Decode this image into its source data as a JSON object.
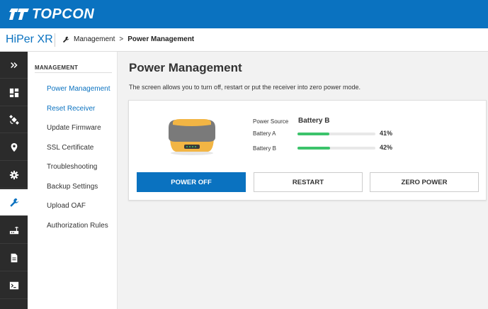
{
  "brand": {
    "logo_text": "TOPCON",
    "product": "HiPer XR"
  },
  "breadcrumb": {
    "parent": "Management",
    "separator": ">",
    "current": "Power Management"
  },
  "rail": {
    "items": [
      {
        "icon": "expand-icon"
      },
      {
        "icon": "dashboard-icon"
      },
      {
        "icon": "satellite-icon"
      },
      {
        "icon": "location-pin-icon"
      },
      {
        "icon": "gear-icon"
      },
      {
        "icon": "wrench-icon",
        "active": true
      },
      {
        "icon": "router-icon"
      },
      {
        "icon": "document-icon"
      },
      {
        "icon": "terminal-icon"
      }
    ]
  },
  "menu": {
    "title": "MANAGEMENT",
    "items": [
      {
        "label": "Power Management"
      },
      {
        "label": "Reset Receiver"
      },
      {
        "label": "Update Firmware"
      },
      {
        "label": "SSL Certificate"
      },
      {
        "label": "Troubleshooting"
      },
      {
        "label": "Backup Settings"
      },
      {
        "label": "Upload OAF"
      },
      {
        "label": "Authorization Rules"
      }
    ]
  },
  "main": {
    "title": "Power Management",
    "description": "The screen allows you to turn off, restart or put the receiver into zero power mode.",
    "power_source_label": "Power Source",
    "power_source_value": "Battery B",
    "batteries": [
      {
        "label": "Battery A",
        "percent_text": "41%",
        "level": 0.41
      },
      {
        "label": "Battery B",
        "percent_text": "42%",
        "level": 0.42
      }
    ],
    "buttons": {
      "power_off": "POWER OFF",
      "restart": "RESTART",
      "zero_power": "ZERO POWER"
    }
  },
  "colors": {
    "brand_blue": "#0a72c0",
    "rail_dark": "#2b2b2b",
    "battery_green": "#3cc36b"
  }
}
